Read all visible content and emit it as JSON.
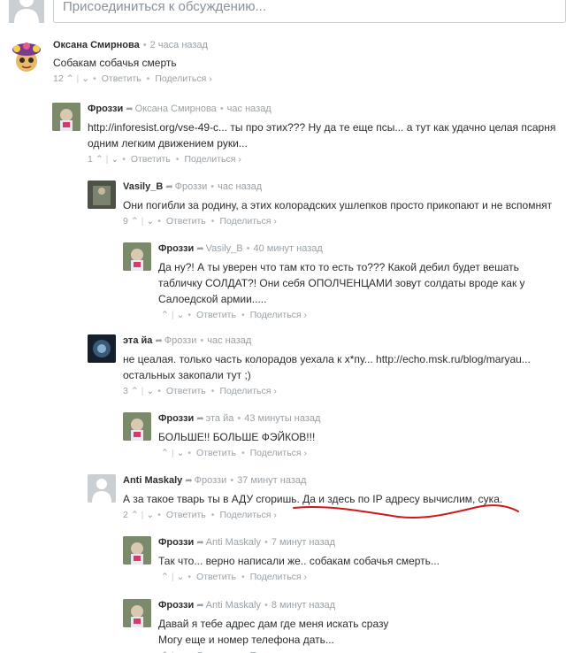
{
  "join": {
    "placeholder": "Присоединиться к обсуждению..."
  },
  "labels": {
    "reply": "Ответить",
    "share": "Поделиться ›",
    "up": "⌃",
    "down": "⌄",
    "bullet": "•",
    "reply_icon": "➦"
  },
  "comments": [
    {
      "id": "c1",
      "author": "Оксана Смирнова",
      "parent": "",
      "time": "2 часа назад",
      "text": "Собакам собачья смерть",
      "votes": "12",
      "avatar": "flower-hat-avatar"
    },
    {
      "id": "c2",
      "author": "Фроззи",
      "parent": "Оксана Смирнова",
      "time": "час назад",
      "text_link": "http://inforesist.org/vse-49-c...",
      "text": " ты про этих??? Ну да те еще псы... а тут как удачно целая псарня одним легким движением руки...",
      "votes": "1",
      "avatar": "frozzi-avatar"
    },
    {
      "id": "c3",
      "author": "Vasily_B",
      "parent": "Фроззи",
      "time": "час назад",
      "text": "Они погибли за родину, а этих колорадских ушлепков просто прикопают и не вспомнят",
      "votes": "9",
      "avatar": "vasily-avatar"
    },
    {
      "id": "c4",
      "author": "Фроззи",
      "parent": "Vasily_B",
      "time": "40 минут назад",
      "text": "Да ну?! А ты уверен что там кто то есть то??? Какой дебил будет вешать табличку СОЛДАТ?! Они себя ОПОЛЧЕНЦАМИ зовут солдаты вроде как у Салоедской армии.....",
      "votes": "",
      "avatar": "frozzi-avatar"
    },
    {
      "id": "c5",
      "author": "эта йа",
      "parent": "Фроззи",
      "time": "час назад",
      "text": "не цеалая. только часть колорадов уехала к х*пу... ",
      "text_link": "http://echo.msk.ru/blog/maryau...",
      "text2": "остальных закопали тут ;)",
      "votes": "3",
      "avatar": "eta-avatar"
    },
    {
      "id": "c6",
      "author": "Фроззи",
      "parent": "эта йа",
      "time": "43 минуты назад",
      "text": "БОЛЬШЕ!! БОЛЬШЕ ФЭЙКОВ!!!",
      "votes": "",
      "avatar": "frozzi-avatar"
    },
    {
      "id": "c7",
      "author": "Anti Maskaly",
      "parent": "Фроззи",
      "time": "37 минут назад",
      "text": "А за такое тварь ты в АДУ сгоришь. Да и здесь по IP адресу вычислим, сука.",
      "votes": "2",
      "avatar": "default-avatar"
    },
    {
      "id": "c8",
      "author": "Фроззи",
      "parent": "Anti Maskaly",
      "time": "7 минут назад",
      "text": "Так что... верно написали же.. собакам собачья смерть...",
      "votes": "",
      "avatar": "frozzi-avatar"
    },
    {
      "id": "c9",
      "author": "Фроззи",
      "parent": "Anti Maskaly",
      "time": "8 минут назад",
      "text": "Давай я тебе адрес дам где меня искать сразу",
      "text2": "Могу еще и номер телефона дать...",
      "votes": "",
      "avatar": "frozzi-avatar"
    }
  ],
  "colors": {
    "meta": "#9aa1a6",
    "text": "#2a2e2e",
    "underline": "#cc1a1a"
  }
}
